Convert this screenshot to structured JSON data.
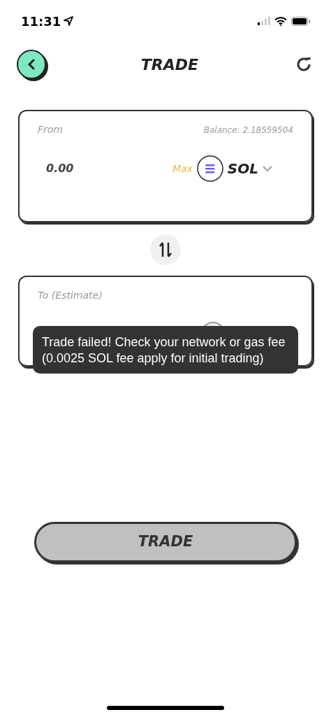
{
  "status_bar": {
    "time": "11:31"
  },
  "header": {
    "title": "TRADE"
  },
  "from": {
    "label": "From",
    "balance": "Balance: 2.18559504",
    "amount": "0.00",
    "max": "Max",
    "token": "SOL"
  },
  "to": {
    "label": "To (Estimate)"
  },
  "toast": {
    "message": "Trade failed! Check your network or gas fee (0.0025 SOL fee apply for initial trading)"
  },
  "trade_button": {
    "label": "TRADE",
    "disabled": true
  }
}
